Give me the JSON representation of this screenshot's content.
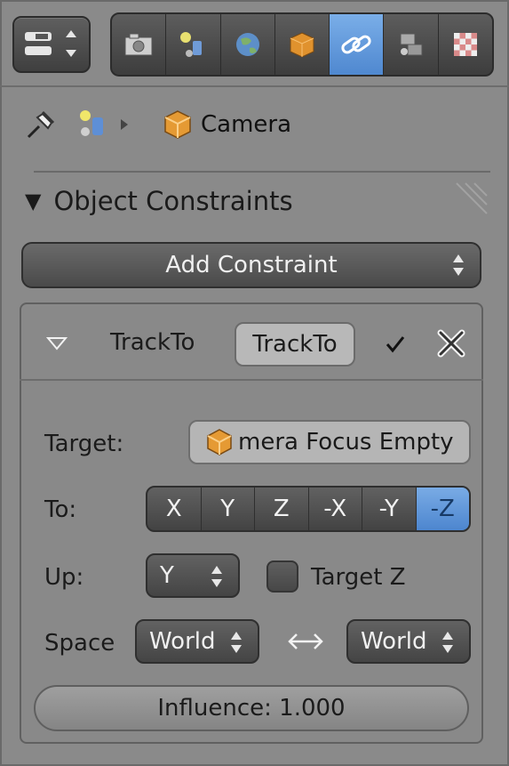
{
  "header": {
    "tabs": [
      {
        "icon": "render-camera-icon",
        "active": false
      },
      {
        "icon": "scene-icon",
        "active": false
      },
      {
        "icon": "world-icon",
        "active": false
      },
      {
        "icon": "object-icon",
        "active": false
      },
      {
        "icon": "constraint-link-icon",
        "active": true
      },
      {
        "icon": "modifiers-icon",
        "active": false
      },
      {
        "icon": "texture-icon",
        "active": false
      }
    ]
  },
  "breadcrumb": {
    "object_name": "Camera"
  },
  "section": {
    "title": "Object Constraints"
  },
  "add_constraint": {
    "label": "Add Constraint"
  },
  "constraint": {
    "type_label": "TrackTo",
    "name_value": "TrackTo",
    "enabled": true,
    "target_label": "Target:",
    "target_value": "mera Focus Empty",
    "to_label": "To:",
    "axes": [
      "X",
      "Y",
      "Z",
      "-X",
      "-Y",
      "-Z"
    ],
    "axis_selected": "-Z",
    "up_label": "Up:",
    "up_value": "Y",
    "target_z_label": "Target Z",
    "target_z_checked": false,
    "space_label": "Space",
    "owner_space": "World",
    "target_space": "World",
    "influence_label": "Influence: 1.000"
  },
  "colors": {
    "accent": "#5a93d8",
    "panel": "#8a8a8a",
    "button_dark": "#4a4a4a"
  }
}
